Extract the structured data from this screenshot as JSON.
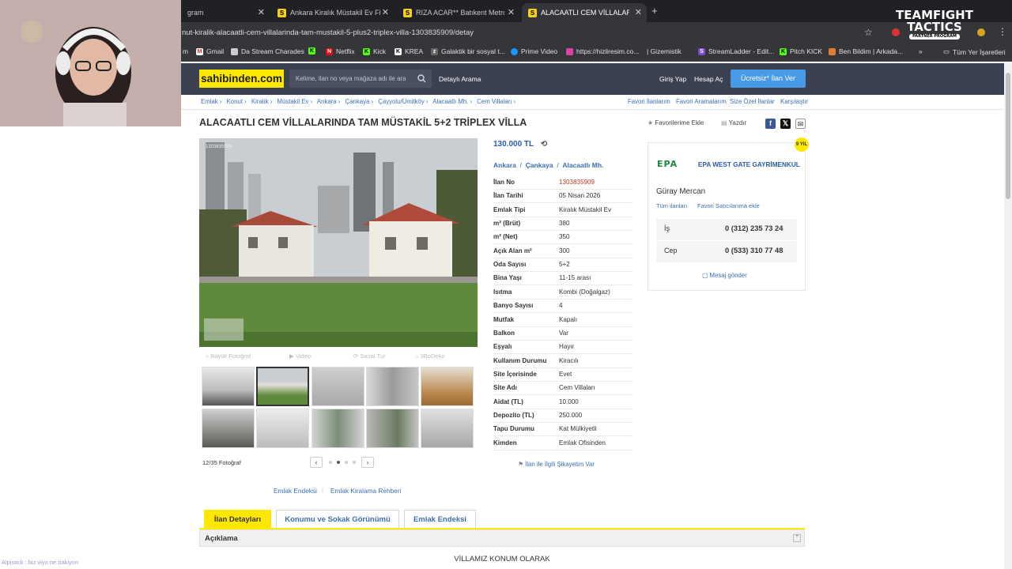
{
  "browser": {
    "tabs": [
      {
        "label": "gram",
        "favicon": ""
      },
      {
        "label": "Ankara Kiralık Müstakil Ev Fiyatları",
        "favicon": "S"
      },
      {
        "label": "RIZA ACAR** Batıkent Metro Ya",
        "favicon": "S"
      },
      {
        "label": "ALACAATLI CEM VİLLALARINDA",
        "favicon": "S"
      }
    ],
    "new_tab": "+",
    "url": "nut-kiralik-alacaatli-cem-villalarinda-tam-mustakil-5-plus2-triplex-villa-1303835909/detay",
    "bookmarks": [
      "m",
      "Gmail",
      "Da Stream Charades",
      "K",
      "Netflix",
      "Kick",
      "KREA",
      "Galaktik bir sosyal t...",
      "Prime Video",
      "https://hizliresim.co...",
      "| Gizemistik",
      "StreamLadder - Edit...",
      "Pitch KICK",
      "Ben Bildim | Arkada...",
      "»",
      "Tüm Yer İşaretleri"
    ]
  },
  "overlay": {
    "tft_line1": "TEAMFIGHT",
    "tft_line2": "TACTICS",
    "tft_line3": "PARTNER PROGRAM",
    "chat": "Alpistick : biz viyo ne bakiyon"
  },
  "header": {
    "logo": "sahibinden.com",
    "search_placeholder": "Kelime, ilan no veya mağaza adı ile ara",
    "detailed_search": "Detaylı Arama",
    "login": "Giriş Yap",
    "register": "Hesap Aç",
    "post_ad": "Ücretsiz* İlan Ver"
  },
  "breadcrumb": [
    "Emlak ›",
    "Konut ›",
    "Kiralık ›",
    "Müstakil Ev ›",
    "Ankara ›",
    "Çankaya ›",
    "Çayyolu/Ümitköy ›",
    "Alacaatlı Mh. ›",
    "Cem Villaları ›"
  ],
  "breadcrumb_right": [
    "Favori İlanlarım",
    "Favori Aramalarım",
    "Size Özel İlanlar",
    "Karşılaştır"
  ],
  "listing": {
    "title": "ALACAATLI CEM VİLLALARINDA TAM MÜSTAKİL 5+2 TRİPLEX VİLLA",
    "add_favorite": "Favorilerime Ekle",
    "print": "Yazdır",
    "price": "130.000 TL",
    "location": [
      "Ankara",
      "Çankaya",
      "Alacaatlı Mh."
    ],
    "photo_watermark": "1303835909",
    "media_tabs": [
      "Büyük Fotoğraf",
      "Video",
      "Sanal Tur",
      "3BoDeko"
    ],
    "photo_count": "12/35 Fotoğraf",
    "details": [
      {
        "k": "İlan No",
        "v": "1303835909"
      },
      {
        "k": "İlan Tarihi",
        "v": "05 Nisan 2026"
      },
      {
        "k": "Emlak Tipi",
        "v": "Kiralık Müstakil Ev"
      },
      {
        "k": "m² (Brüt)",
        "v": "380"
      },
      {
        "k": "m² (Net)",
        "v": "350"
      },
      {
        "k": "Açık Alan m²",
        "v": "300"
      },
      {
        "k": "Oda Sayısı",
        "v": "5+2"
      },
      {
        "k": "Bina Yaşı",
        "v": "11-15 arası"
      },
      {
        "k": "Isıtma",
        "v": "Kombi (Doğalgaz)"
      },
      {
        "k": "Banyo Sayısı",
        "v": "4"
      },
      {
        "k": "Mutfak",
        "v": "Kapalı"
      },
      {
        "k": "Balkon",
        "v": "Var"
      },
      {
        "k": "Eşyalı",
        "v": "Hayır"
      },
      {
        "k": "Kullanım Durumu",
        "v": "Kiracılı"
      },
      {
        "k": "Site İçerisinde",
        "v": "Evet"
      },
      {
        "k": "Site Adı",
        "v": "Cem Villaları"
      },
      {
        "k": "Aidat (TL)",
        "v": "10.000"
      },
      {
        "k": "Depozito (TL)",
        "v": "250.000"
      },
      {
        "k": "Tapu Durumu",
        "v": "Kat Mülkiyetli"
      },
      {
        "k": "Kimden",
        "v": "Emlak Ofisinden"
      }
    ],
    "complaint": "İlan ile İlgili Şikayetim Var"
  },
  "seller": {
    "logo": "EPA",
    "badge": "9 YIL",
    "agency": "EPA WEST GATE GAYRİMENKUL",
    "agent": "Güray Mercan",
    "all_listings": "Tüm ilanları",
    "add_fav_seller": "Favori Satıcılarıma ekle",
    "phones": [
      {
        "label": "İş",
        "number": "0 (312) 235 73 24"
      },
      {
        "label": "Cep",
        "number": "0 (533) 310 77 48"
      }
    ],
    "send_message": "Mesaj gönder"
  },
  "bottom": {
    "links": [
      "Emlak Endeksi",
      "Emlak Kiralama Rehberi"
    ],
    "tabs": [
      "İlan Detayları",
      "Konumu ve Sokak Görünümü",
      "Emlak Endeksi"
    ],
    "section": "Açıklama",
    "description_start": "VİLLAMIZ KONUM OLARAK"
  }
}
